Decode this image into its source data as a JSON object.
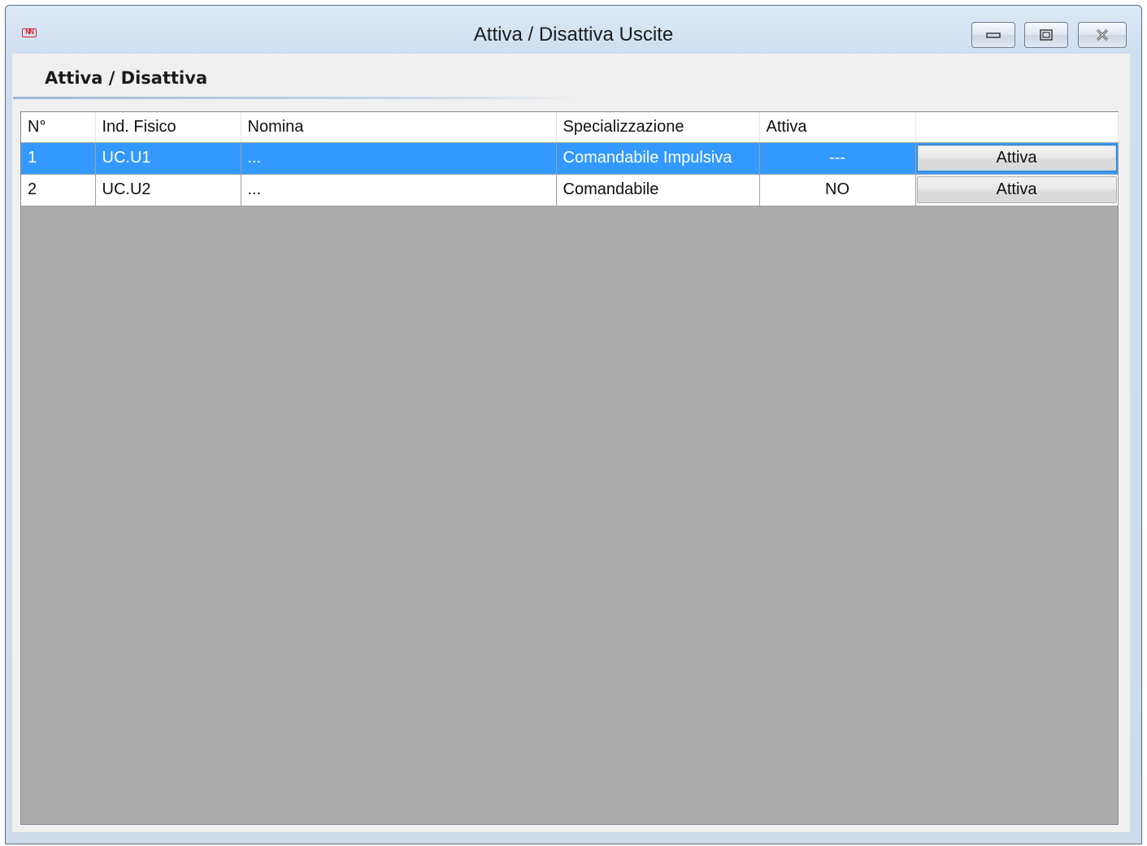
{
  "window": {
    "title": "Attiva / Disattiva Uscite",
    "app_icon_text": "NN"
  },
  "section": {
    "title": "Attiva / Disattiva"
  },
  "grid": {
    "columns": [
      "N°",
      "Ind. Fisico",
      "Nomina",
      "Specializzazione",
      "Attiva",
      ""
    ],
    "rows": [
      {
        "n": "1",
        "ind": "UC.U1",
        "nomina": "...",
        "spec": "Comandabile Impulsiva",
        "attiva": "---",
        "action": "Attiva",
        "selected": true
      },
      {
        "n": "2",
        "ind": "UC.U2",
        "nomina": "...",
        "spec": "Comandabile",
        "attiva": "NO",
        "action": "Attiva",
        "selected": false
      }
    ]
  },
  "colors": {
    "selection": "#3399ff",
    "grid_background": "#ababab"
  }
}
